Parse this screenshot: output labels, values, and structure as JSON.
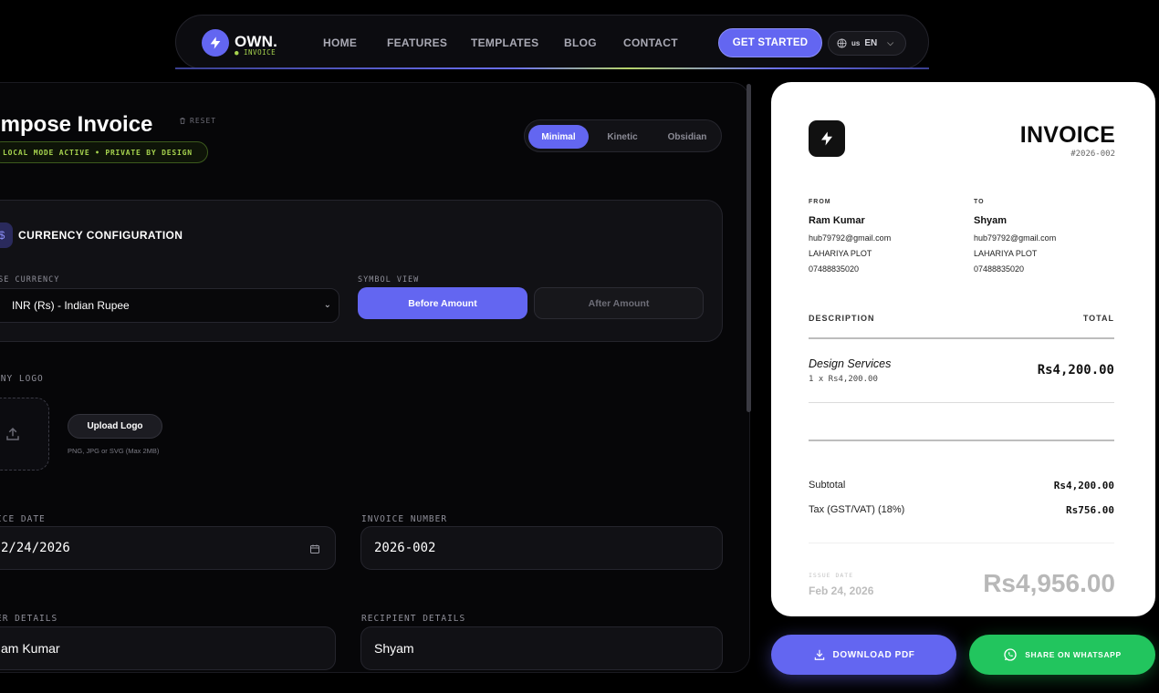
{
  "nav": {
    "logo_title": "OWN.",
    "logo_sub": "● INVOICE",
    "links": [
      "HOME",
      "FEATURES",
      "TEMPLATES",
      "BLOG",
      "CONTACT"
    ],
    "cta": "GET STARTED",
    "lang_flag": "us",
    "lang_code": "EN"
  },
  "compose": {
    "title": "ompose Invoice",
    "reset": "RESET",
    "status": "LOCAL MODE ACTIVE • PRIVATE BY DESIGN",
    "themes": [
      "Minimal",
      "Kinetic",
      "Obsidian"
    ],
    "active_theme": "Minimal"
  },
  "currency": {
    "icon": "$",
    "title": "CURRENCY CONFIGURATION",
    "base_label": "ASE CURRENCY",
    "base_value": "INR (Rs) - Indian Rupee",
    "symbol_label": "SYMBOL VIEW",
    "before": "Before Amount",
    "after": "After Amount"
  },
  "logo_section": {
    "label": "ANY LOGO",
    "upload": "Upload Logo",
    "hint": "PNG, JPG or SVG (Max 2MB)"
  },
  "fields": {
    "date_label": "ICE DATE",
    "date_value": "2/24/2026",
    "number_label": "INVOICE NUMBER",
    "number_value": "2026-002",
    "sender_label": "ER DETAILS",
    "sender_value": "am Kumar",
    "recipient_label": "RECIPIENT DETAILS",
    "recipient_value": "Shyam"
  },
  "invoice": {
    "heading": "INVOICE",
    "number": "#2026-002",
    "from_label": "FROM",
    "from": {
      "name": "Ram Kumar",
      "email": "hub79792@gmail.com",
      "address": "LAHARIYA PLOT",
      "phone": "07488835020"
    },
    "to_label": "TO",
    "to": {
      "name": "Shyam",
      "email": "hub79792@gmail.com",
      "address": "LAHARIYA PLOT",
      "phone": "07488835020"
    },
    "desc_header": "DESCRIPTION",
    "total_header": "TOTAL",
    "item": {
      "name": "Design Services",
      "detail": "1 x Rs4,200.00",
      "amount": "Rs4,200.00"
    },
    "subtotal_label": "Subtotal",
    "subtotal": "Rs4,200.00",
    "tax_label": "Tax (GST/VAT) (18%)",
    "tax": "Rs756.00",
    "issue_label": "ISSUE DATE",
    "issue_date": "Feb 24, 2026",
    "grand_total": "Rs4,956.00"
  },
  "actions": {
    "pdf": "DOWNLOAD PDF",
    "whatsapp": "SHARE ON WHATSAPP"
  },
  "colors": {
    "accent": "#6366f1",
    "lime": "#a6d34e",
    "whatsapp": "#22c55e"
  }
}
